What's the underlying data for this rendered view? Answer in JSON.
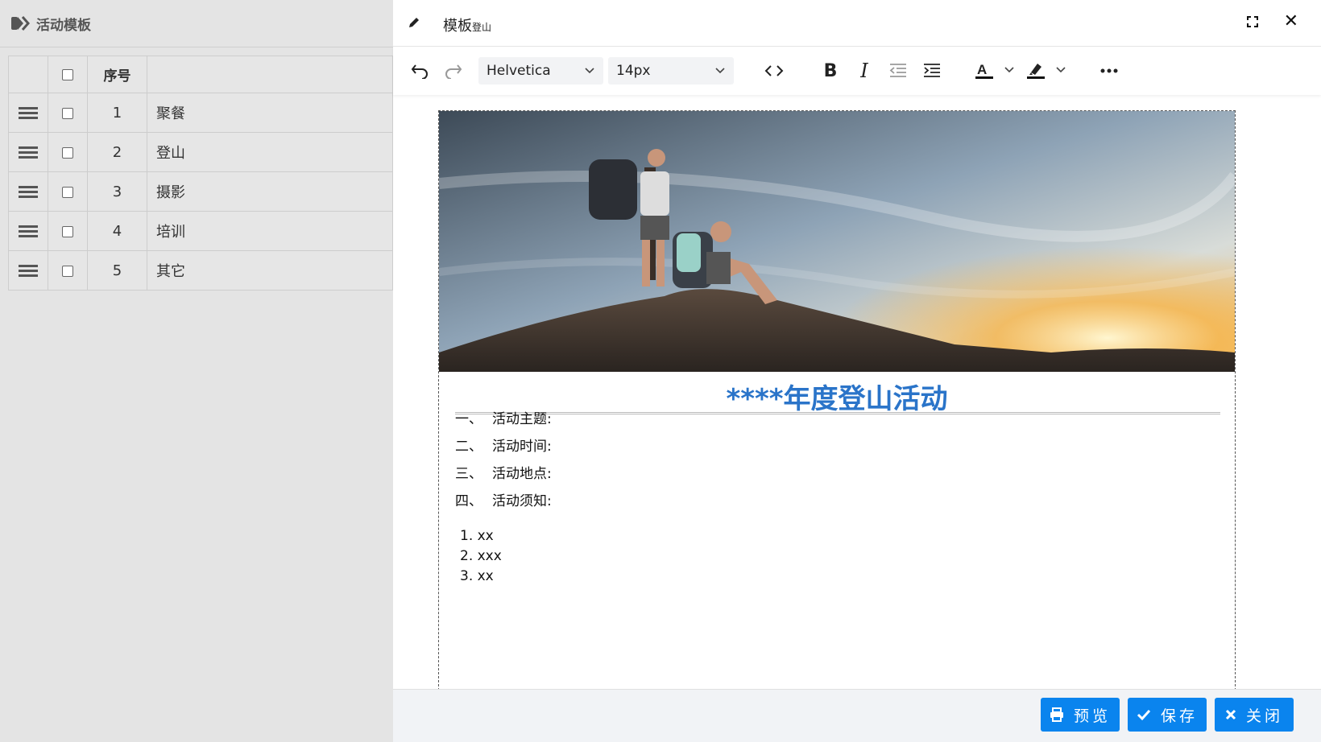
{
  "left_panel": {
    "title": "活动模板",
    "columns": {
      "no": "序号",
      "name": ""
    },
    "rows": [
      {
        "no": "1",
        "name": "聚餐"
      },
      {
        "no": "2",
        "name": "登山"
      },
      {
        "no": "3",
        "name": "摄影"
      },
      {
        "no": "4",
        "name": "培训"
      },
      {
        "no": "5",
        "name": "其它"
      }
    ]
  },
  "dialog": {
    "title": "模板",
    "subtitle": "登山",
    "toolbar": {
      "font_family": "Helvetica",
      "font_size": "14px",
      "icons": [
        "undo-icon",
        "redo-icon",
        "code-icon",
        "bold-icon",
        "italic-icon",
        "outdent-icon",
        "indent-icon",
        "text-color-icon",
        "highlight-icon",
        "more-icon"
      ]
    },
    "document": {
      "heading": "****年度登山活动",
      "sections": [
        {
          "num": "一、",
          "text": "活动主题:"
        },
        {
          "num": "二、",
          "text": "活动时间:"
        },
        {
          "num": "三、",
          "text": "活动地点:"
        },
        {
          "num": "四、",
          "text": "活动须知:"
        }
      ],
      "list": [
        "1. xx",
        "2. xxx",
        "3. xx"
      ]
    },
    "footer": {
      "preview": "预览",
      "save": "保存",
      "close": "关闭"
    }
  },
  "colors": {
    "accent": "#0a84ee",
    "heading": "#2a74c9",
    "panel_bg": "#e4e4e4"
  }
}
